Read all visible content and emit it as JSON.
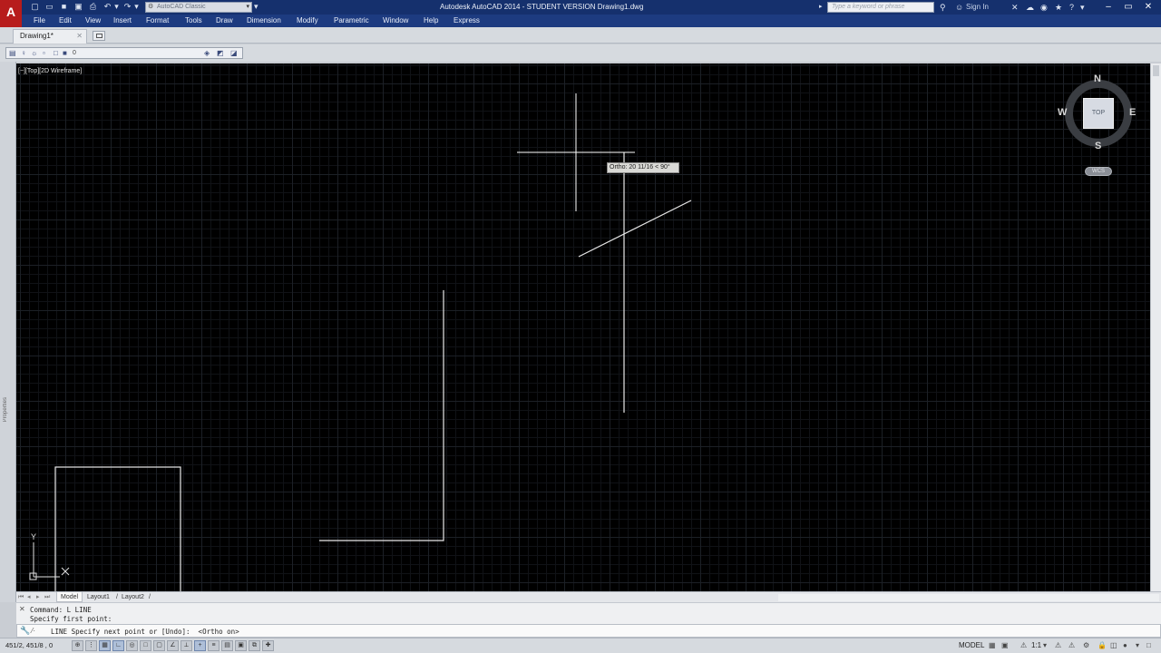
{
  "app": {
    "logo_letter": "A",
    "window_title": "Autodesk AutoCAD 2014 - STUDENT VERSION    Drawing1.dwg"
  },
  "quick_access": {
    "workspace": "AutoCAD Classic",
    "icons": [
      "new-icon",
      "open-icon",
      "save-icon",
      "save-as-icon",
      "print-icon",
      "undo-icon",
      "redo-icon"
    ]
  },
  "search": {
    "placeholder": "Type a keyword or phrase"
  },
  "account": {
    "sign_in": "Sign In"
  },
  "menu": [
    "File",
    "Edit",
    "View",
    "Insert",
    "Format",
    "Tools",
    "Draw",
    "Dimension",
    "Modify",
    "Parametric",
    "Window",
    "Help",
    "Express"
  ],
  "tabs": {
    "active": "Drawing1*"
  },
  "layer": {
    "current": "0"
  },
  "left_palette": {
    "label": "Properties"
  },
  "viewport": {
    "label": "[−][Top][2D Wireframe]"
  },
  "tooltip": {
    "text": "Ortho: 20 11/16 < 90°"
  },
  "viewcube": {
    "top": "TOP",
    "north": "N",
    "south": "S",
    "east": "E",
    "west": "W",
    "wcs": "WCS"
  },
  "ucs": {
    "x_label": "X",
    "y_label": "Y"
  },
  "layout_tabs": [
    "Model",
    "Layout1",
    "Layout2"
  ],
  "command": {
    "history": [
      "Command: L LINE",
      "Specify first point:"
    ],
    "current": "LINE Specify next point or [Undo]:  <Ortho on>"
  },
  "status": {
    "coords": "451/2, 451/8 , 0",
    "model": "MODEL",
    "scale": "1:1",
    "colors": {
      "toggle_on": "#aebfd8",
      "drawing_bg": "#000000",
      "title_bar": "#15306d"
    }
  }
}
